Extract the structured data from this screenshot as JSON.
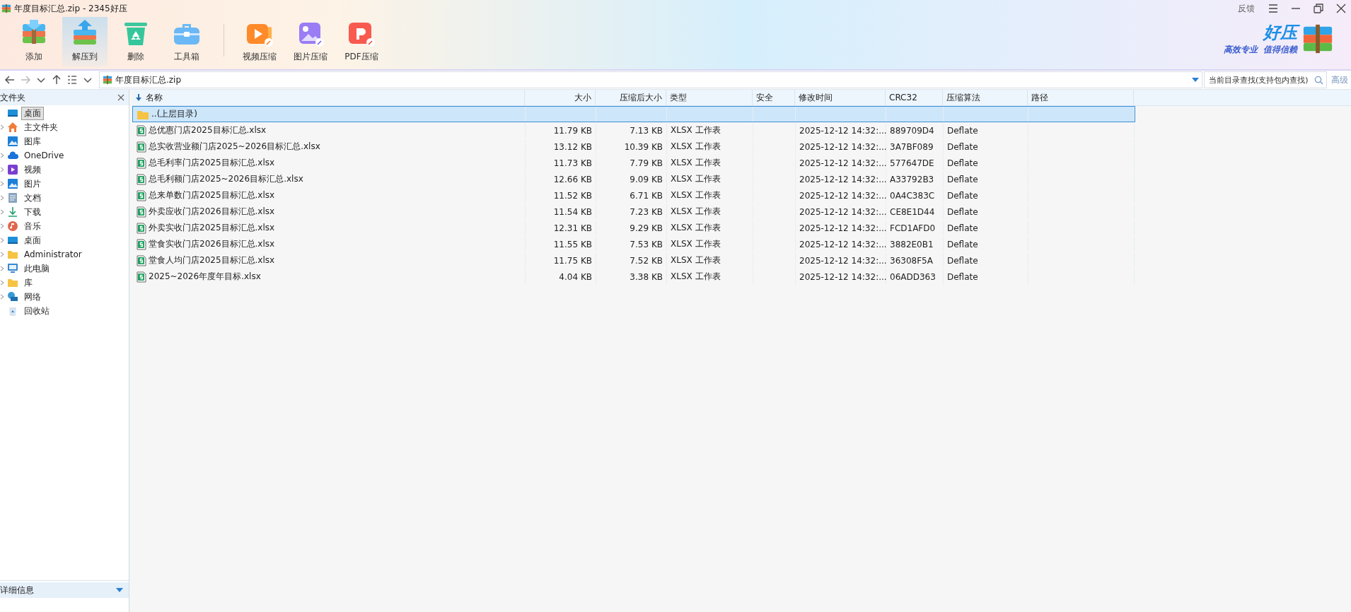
{
  "window": {
    "title": "年度目标汇总.zip - 2345好压",
    "feedback": "反馈"
  },
  "toolbar": [
    {
      "label": "添加",
      "kind": "add",
      "selected": false
    },
    {
      "label": "解压到",
      "kind": "extract",
      "selected": true
    },
    {
      "label": "删除",
      "kind": "delete",
      "selected": false
    },
    {
      "label": "工具箱",
      "kind": "toolbox",
      "selected": false
    },
    {
      "label": "视频压缩",
      "kind": "video",
      "selected": false
    },
    {
      "label": "图片压缩",
      "kind": "image",
      "selected": false
    },
    {
      "label": "PDF压缩",
      "kind": "pdf",
      "selected": false
    }
  ],
  "brand": {
    "name": "好压",
    "slogan": "高效专业  值得信赖"
  },
  "address_bar": {
    "path": "年度目标汇总.zip",
    "search_placeholder": "当前目录查找(支持包内查找)",
    "advanced": "高级"
  },
  "sidebar": {
    "title": "文件夹",
    "items": [
      {
        "label": "桌面",
        "kind": "desktop",
        "selected": true,
        "expandable": false,
        "children": [
          {
            "label": "主文件夹",
            "kind": "home",
            "selected": false,
            "expandable": true
          },
          {
            "label": "图库",
            "kind": "gallery",
            "selected": false,
            "expandable": false
          },
          {
            "label": "OneDrive",
            "kind": "cloud",
            "selected": false,
            "expandable": true
          },
          {
            "label": "视频",
            "kind": "video",
            "selected": false,
            "expandable": true
          },
          {
            "label": "图片",
            "kind": "gallery",
            "selected": false,
            "expandable": true
          },
          {
            "label": "文档",
            "kind": "doc",
            "selected": false,
            "expandable": true
          },
          {
            "label": "下载",
            "kind": "download",
            "selected": false,
            "expandable": true
          },
          {
            "label": "音乐",
            "kind": "music",
            "selected": false,
            "expandable": true
          },
          {
            "label": "桌面",
            "kind": "desktop",
            "selected": false,
            "expandable": true
          },
          {
            "label": "Administrator",
            "kind": "folder",
            "selected": false,
            "expandable": true
          },
          {
            "label": "此电脑",
            "kind": "pc",
            "selected": false,
            "expandable": true
          },
          {
            "label": "库",
            "kind": "folder",
            "selected": false,
            "expandable": true
          },
          {
            "label": "网络",
            "kind": "network",
            "selected": false,
            "expandable": true
          },
          {
            "label": "回收站",
            "kind": "bin",
            "selected": false,
            "expandable": false
          }
        ]
      }
    ],
    "details_title": "详细信息"
  },
  "table": {
    "columns": [
      "名称",
      "大小",
      "压缩后大小",
      "类型",
      "安全",
      "修改时间",
      "CRC32",
      "压缩算法",
      "路径"
    ],
    "rows": [
      {
        "kind": "folder",
        "selected": true,
        "name": "..(上层目录)"
      },
      {
        "kind": "file",
        "selected": false,
        "name": "总优惠门店2025目标汇总.xlsx",
        "size": "11.79 KB",
        "packed": "7.13 KB",
        "type": "XLSX 工作表",
        "modified": "2025-12-12 14:32:...",
        "crc": "889709D4",
        "method": "Deflate"
      },
      {
        "kind": "file",
        "selected": false,
        "name": "总实收营业额门店2025~2026目标汇总.xlsx",
        "size": "13.12 KB",
        "packed": "10.39 KB",
        "type": "XLSX 工作表",
        "modified": "2025-12-12 14:32:...",
        "crc": "3A7BF089",
        "method": "Deflate"
      },
      {
        "kind": "file",
        "selected": false,
        "name": "总毛利率门店2025目标汇总.xlsx",
        "size": "11.73 KB",
        "packed": "7.79 KB",
        "type": "XLSX 工作表",
        "modified": "2025-12-12 14:32:...",
        "crc": "577647DE",
        "method": "Deflate"
      },
      {
        "kind": "file",
        "selected": false,
        "name": "总毛利额门店2025~2026目标汇总.xlsx",
        "size": "12.66 KB",
        "packed": "9.09 KB",
        "type": "XLSX 工作表",
        "modified": "2025-12-12 14:32:...",
        "crc": "A33792B3",
        "method": "Deflate"
      },
      {
        "kind": "file",
        "selected": false,
        "name": "总来单数门店2025目标汇总.xlsx",
        "size": "11.52 KB",
        "packed": "6.71 KB",
        "type": "XLSX 工作表",
        "modified": "2025-12-12 14:32:...",
        "crc": "0A4C383C",
        "method": "Deflate"
      },
      {
        "kind": "file",
        "selected": false,
        "name": "外卖应收门店2026目标汇总.xlsx",
        "size": "11.54 KB",
        "packed": "7.23 KB",
        "type": "XLSX 工作表",
        "modified": "2025-12-12 14:32:...",
        "crc": "CE8E1D44",
        "method": "Deflate"
      },
      {
        "kind": "file",
        "selected": false,
        "name": "外卖实收门店2025目标汇总.xlsx",
        "size": "12.31 KB",
        "packed": "9.29 KB",
        "type": "XLSX 工作表",
        "modified": "2025-12-12 14:32:...",
        "crc": "FCD1AFD0",
        "method": "Deflate"
      },
      {
        "kind": "file",
        "selected": false,
        "name": "堂食实收门店2026目标汇总.xlsx",
        "size": "11.55 KB",
        "packed": "7.53 KB",
        "type": "XLSX 工作表",
        "modified": "2025-12-12 14:32:...",
        "crc": "3882E0B1",
        "method": "Deflate"
      },
      {
        "kind": "file",
        "selected": false,
        "name": "堂食人均门店2025目标汇总.xlsx",
        "size": "11.75 KB",
        "packed": "7.52 KB",
        "type": "XLSX 工作表",
        "modified": "2025-12-12 14:32:...",
        "crc": "36308F5A",
        "method": "Deflate"
      },
      {
        "kind": "file",
        "selected": false,
        "name": "2025~2026年度年目标.xlsx",
        "size": "4.04 KB",
        "packed": "3.38 KB",
        "type": "XLSX 工作表",
        "modified": "2025-12-12 14:32:...",
        "crc": "06ADD363",
        "method": "Deflate"
      }
    ]
  }
}
